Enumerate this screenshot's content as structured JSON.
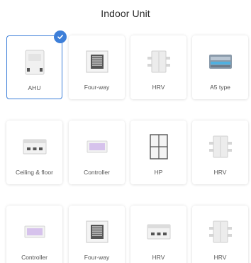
{
  "header": {
    "title": "Indoor Unit"
  },
  "colors": {
    "accent": "#3d7fd9"
  },
  "units": [
    {
      "label": "AHU",
      "icon": "ahu-icon",
      "selected": true
    },
    {
      "label": "Four-way",
      "icon": "four-way-cassette-icon",
      "selected": false
    },
    {
      "label": "HRV",
      "icon": "hrv-icon",
      "selected": false
    },
    {
      "label": "A5 type",
      "icon": "a5-type-icon",
      "selected": false
    },
    {
      "label": "Ceiling & floor",
      "icon": "ceiling-floor-icon",
      "selected": false
    },
    {
      "label": "Controller",
      "icon": "controller-icon",
      "selected": false
    },
    {
      "label": "HP",
      "icon": "hp-icon",
      "selected": false
    },
    {
      "label": "HRV",
      "icon": "hrv-icon",
      "selected": false
    },
    {
      "label": "Controller",
      "icon": "controller-icon",
      "selected": false
    },
    {
      "label": "Four-way",
      "icon": "four-way-cassette-icon",
      "selected": false
    },
    {
      "label": "HRV",
      "icon": "ceiling-hrv-icon",
      "selected": false
    },
    {
      "label": "HRV",
      "icon": "hrv-icon",
      "selected": false
    }
  ]
}
